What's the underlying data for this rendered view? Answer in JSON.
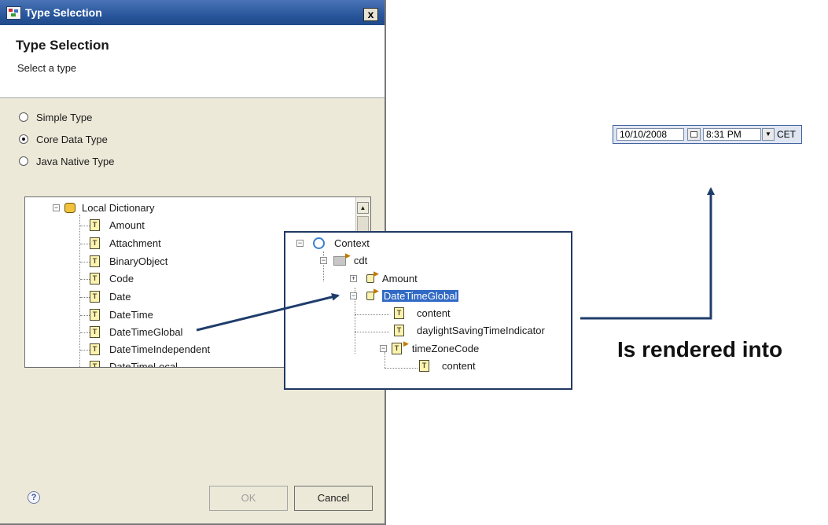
{
  "dialog": {
    "window_title": "Type Selection",
    "close_label": "x",
    "header_title": "Type Selection",
    "header_subtitle": "Select a type",
    "radios": [
      {
        "label": "Simple Type",
        "checked": false
      },
      {
        "label": "Core Data Type",
        "checked": true
      },
      {
        "label": "Java Native Type",
        "checked": false
      }
    ],
    "tree": {
      "root": "Local Dictionary",
      "items": [
        "Amount",
        "Attachment",
        "BinaryObject",
        "Code",
        "Date",
        "DateTime",
        "DateTimeGlobal",
        "DateTimeIndependent",
        "DateTimeLocal"
      ]
    },
    "help_label": "?",
    "ok_label": "OK",
    "cancel_label": "Cancel"
  },
  "context": {
    "root": "Context",
    "cdt": "cdt",
    "amount": "Amount",
    "selected": "DateTimeGlobal",
    "content": "content",
    "dst": "daylightSavingTimeIndicator",
    "tz": "timeZoneCode",
    "tz_content": "content"
  },
  "widget": {
    "date": "10/10/2008",
    "time": "8:31 PM",
    "timezone": "CET"
  },
  "caption": "Is rendered into",
  "colors": {
    "titlebar": "#29569c",
    "arrow": "#1f3d6b",
    "selection": "#316ac5"
  }
}
